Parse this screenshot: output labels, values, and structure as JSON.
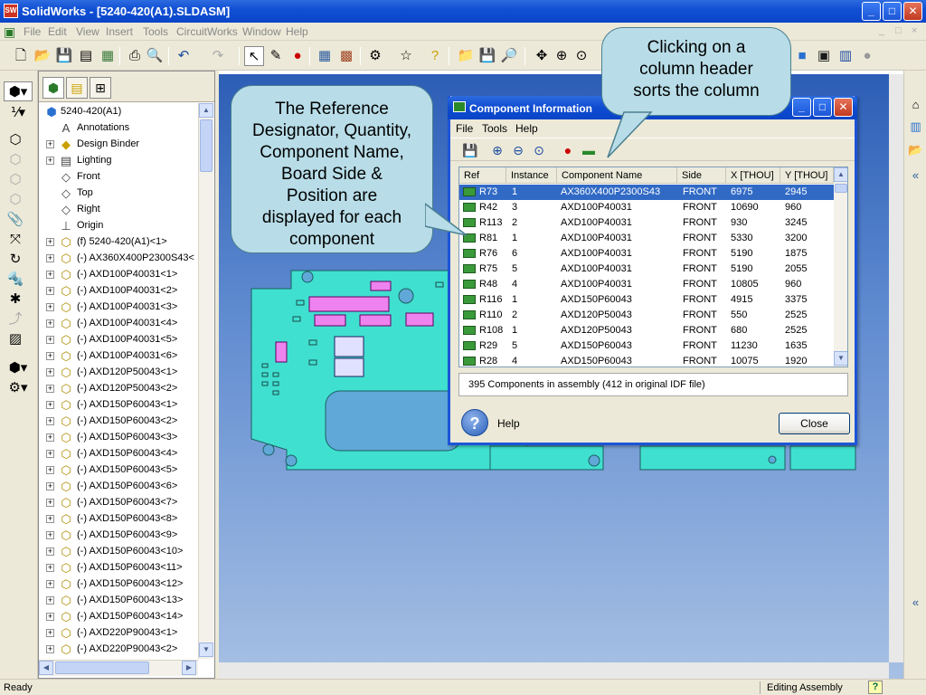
{
  "window": {
    "title": "SolidWorks - [5240-420(A1).SLDASM]",
    "app_icon_text": "SW",
    "controls": {
      "minimize": "_",
      "maximize": "□",
      "close": "✕"
    }
  },
  "menubar": {
    "items": [
      "File",
      "Edit",
      "View",
      "Insert",
      "Tools",
      "CircuitWorks",
      "Window",
      "Help"
    ],
    "mdi_controls": [
      "_",
      "□",
      "×"
    ]
  },
  "feature_tree": {
    "root": "5240-420(A1)",
    "items": [
      {
        "label": "Annotations",
        "expandable": false,
        "icon": "annotation-icon"
      },
      {
        "label": "Design Binder",
        "expandable": true,
        "icon": "design-binder-icon"
      },
      {
        "label": "Lighting",
        "expandable": true,
        "icon": "lighting-folder-icon"
      },
      {
        "label": "Front",
        "expandable": false,
        "icon": "plane-icon"
      },
      {
        "label": "Top",
        "expandable": false,
        "icon": "plane-icon"
      },
      {
        "label": "Right",
        "expandable": false,
        "icon": "plane-icon"
      },
      {
        "label": "Origin",
        "expandable": false,
        "icon": "origin-icon"
      },
      {
        "label": "(f) 5240-420(A1)<1>",
        "expandable": true,
        "icon": "part-icon"
      },
      {
        "label": "(-) AX360X400P2300S43<",
        "expandable": true,
        "icon": "part-icon"
      },
      {
        "label": "(-) AXD100P40031<1>",
        "expandable": true,
        "icon": "part-icon"
      },
      {
        "label": "(-) AXD100P40031<2>",
        "expandable": true,
        "icon": "part-icon"
      },
      {
        "label": "(-) AXD100P40031<3>",
        "expandable": true,
        "icon": "part-icon"
      },
      {
        "label": "(-) AXD100P40031<4>",
        "expandable": true,
        "icon": "part-icon"
      },
      {
        "label": "(-) AXD100P40031<5>",
        "expandable": true,
        "icon": "part-icon"
      },
      {
        "label": "(-) AXD100P40031<6>",
        "expandable": true,
        "icon": "part-icon"
      },
      {
        "label": "(-) AXD120P50043<1>",
        "expandable": true,
        "icon": "part-icon"
      },
      {
        "label": "(-) AXD120P50043<2>",
        "expandable": true,
        "icon": "part-icon"
      },
      {
        "label": "(-) AXD150P60043<1>",
        "expandable": true,
        "icon": "part-icon"
      },
      {
        "label": "(-) AXD150P60043<2>",
        "expandable": true,
        "icon": "part-icon"
      },
      {
        "label": "(-) AXD150P60043<3>",
        "expandable": true,
        "icon": "part-icon"
      },
      {
        "label": "(-) AXD150P60043<4>",
        "expandable": true,
        "icon": "part-icon"
      },
      {
        "label": "(-) AXD150P60043<5>",
        "expandable": true,
        "icon": "part-icon"
      },
      {
        "label": "(-) AXD150P60043<6>",
        "expandable": true,
        "icon": "part-icon"
      },
      {
        "label": "(-) AXD150P60043<7>",
        "expandable": true,
        "icon": "part-icon"
      },
      {
        "label": "(-) AXD150P60043<8>",
        "expandable": true,
        "icon": "part-icon"
      },
      {
        "label": "(-) AXD150P60043<9>",
        "expandable": true,
        "icon": "part-icon"
      },
      {
        "label": "(-) AXD150P60043<10>",
        "expandable": true,
        "icon": "part-icon"
      },
      {
        "label": "(-) AXD150P60043<11>",
        "expandable": true,
        "icon": "part-icon"
      },
      {
        "label": "(-) AXD150P60043<12>",
        "expandable": true,
        "icon": "part-icon"
      },
      {
        "label": "(-) AXD150P60043<13>",
        "expandable": true,
        "icon": "part-icon"
      },
      {
        "label": "(-) AXD150P60043<14>",
        "expandable": true,
        "icon": "part-icon"
      },
      {
        "label": "(-) AXD220P90043<1>",
        "expandable": true,
        "icon": "part-icon"
      },
      {
        "label": "(-) AXD220P90043<2>",
        "expandable": true,
        "icon": "part-icon"
      }
    ]
  },
  "dialog": {
    "title": "Component Information",
    "menu": [
      "File",
      "Tools",
      "Help"
    ],
    "columns": [
      "Ref",
      "Instance",
      "Component Name",
      "Side",
      "X [THOU]",
      "Y [THOU]"
    ],
    "rows": [
      [
        "R73",
        "1",
        "AX360X400P2300S43",
        "FRONT",
        "6975",
        "2945"
      ],
      [
        "R42",
        "3",
        "AXD100P40031",
        "FRONT",
        "10690",
        "960"
      ],
      [
        "R113",
        "2",
        "AXD100P40031",
        "FRONT",
        "930",
        "3245"
      ],
      [
        "R81",
        "1",
        "AXD100P40031",
        "FRONT",
        "5330",
        "3200"
      ],
      [
        "R76",
        "6",
        "AXD100P40031",
        "FRONT",
        "5190",
        "1875"
      ],
      [
        "R75",
        "5",
        "AXD100P40031",
        "FRONT",
        "5190",
        "2055"
      ],
      [
        "R48",
        "4",
        "AXD100P40031",
        "FRONT",
        "10805",
        "960"
      ],
      [
        "R116",
        "1",
        "AXD150P60043",
        "FRONT",
        "4915",
        "3375"
      ],
      [
        "R110",
        "2",
        "AXD120P50043",
        "FRONT",
        "550",
        "2525"
      ],
      [
        "R108",
        "1",
        "AXD120P50043",
        "FRONT",
        "680",
        "2525"
      ],
      [
        "R29",
        "5",
        "AXD150P60043",
        "FRONT",
        "11230",
        "1635"
      ],
      [
        "R28",
        "4",
        "AXD150P60043",
        "FRONT",
        "10075",
        "1920"
      ]
    ],
    "selected_row": 0,
    "summary": "395 Components in assembly (412 in original IDF file)",
    "help_label": "Help",
    "close_label": "Close"
  },
  "callouts": {
    "left_lines": [
      "The Reference",
      "Designator, Quantity,",
      "Component Name,",
      "Board Side &",
      "Position are",
      "displayed for each",
      "component"
    ],
    "right_lines": [
      "Clicking on a",
      "column header",
      "sorts the column"
    ]
  },
  "statusbar": {
    "left": "Ready",
    "mode": "Editing Assembly",
    "help_icon": "?"
  },
  "colors": {
    "titlebar": "#0a45c8",
    "pcb": "#40e0d0",
    "pcb_components": "#ee82ee",
    "callout_fill": "#b8dde8",
    "selection": "#316ac5"
  }
}
